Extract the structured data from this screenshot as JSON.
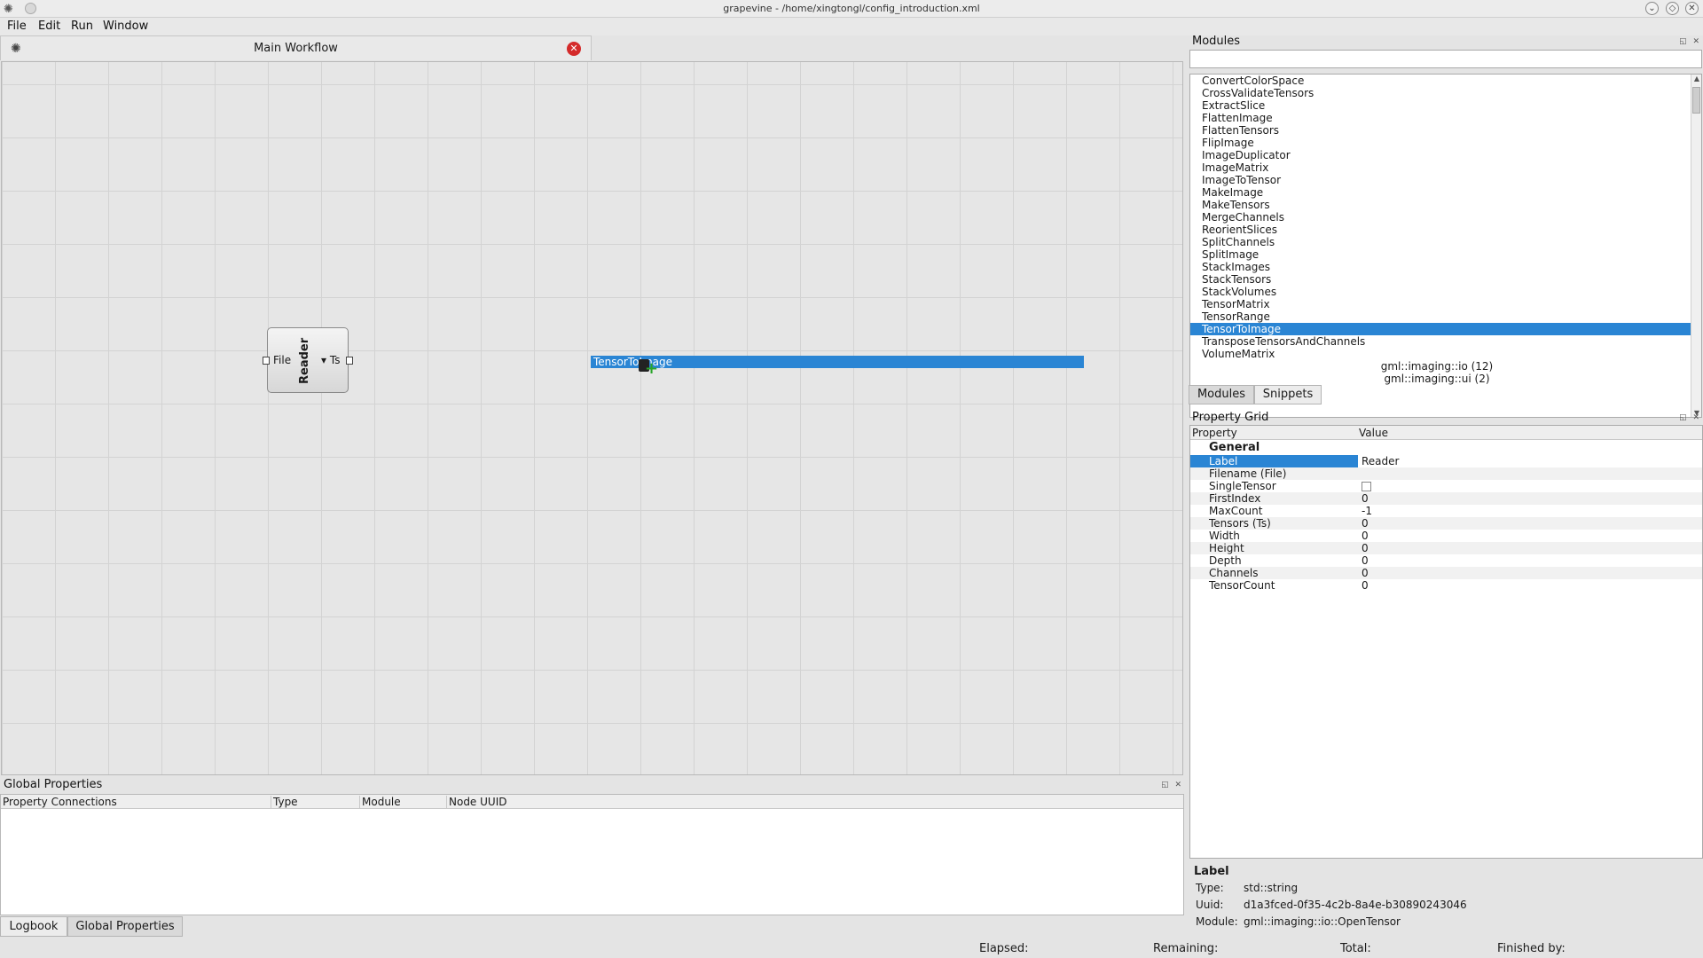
{
  "window": {
    "title": "grapevine - /home/xingtongl/config_introduction.xml",
    "controls": [
      "⌄",
      "◇",
      "✕"
    ]
  },
  "menu": [
    {
      "label": "File",
      "mnemonic": "F"
    },
    {
      "label": "Edit",
      "mnemonic": "E"
    },
    {
      "label": "Run",
      "mnemonic": "R"
    },
    {
      "label": "Window",
      "mnemonic": "W"
    }
  ],
  "workflow_tab": {
    "title": "Main Workflow"
  },
  "canvas": {
    "node": {
      "title": "Reader",
      "input_label": "File",
      "output_label": "Ts"
    },
    "drag_label": "TensorToImage"
  },
  "global_properties": {
    "title": "Global Properties",
    "columns": [
      "Property Connections",
      "Type",
      "Module",
      "Node UUID"
    ]
  },
  "bottom_tabs": [
    "Logbook",
    "Global Properties"
  ],
  "status": {
    "elapsed": "Elapsed:",
    "remaining": "Remaining:",
    "total": "Total:",
    "finished": "Finished by:"
  },
  "modules": {
    "title": "Modules",
    "search_value": "",
    "items": [
      "ConvertColorSpace",
      "CrossValidateTensors",
      "ExtractSlice",
      "FlattenImage",
      "FlattenTensors",
      "FlipImage",
      "ImageDuplicator",
      "ImageMatrix",
      "ImageToTensor",
      "MakeImage",
      "MakeTensors",
      "MergeChannels",
      "ReorientSlices",
      "SplitChannels",
      "SplitImage",
      "StackImages",
      "StackTensors",
      "StackVolumes",
      "TensorMatrix",
      "TensorRange",
      "TensorToImage",
      "TransposeTensorsAndChannels",
      "VolumeMatrix"
    ],
    "selected": "TensorToImage",
    "groups": [
      "gml::imaging::io (12)",
      "gml::imaging::ui (2)"
    ],
    "tabs": [
      "Modules",
      "Snippets"
    ]
  },
  "property_grid": {
    "title": "Property Grid",
    "col_property": "Property",
    "col_value": "Value",
    "section": "General",
    "rows": [
      {
        "key": "Label",
        "value": "Reader"
      },
      {
        "key": "Filename (File)",
        "value": ""
      },
      {
        "key": "SingleTensor",
        "value": ""
      },
      {
        "key": "FirstIndex",
        "value": "0"
      },
      {
        "key": "MaxCount",
        "value": "-1"
      },
      {
        "key": "Tensors (Ts)",
        "value": "0"
      },
      {
        "key": "Width",
        "value": "0"
      },
      {
        "key": "Height",
        "value": "0"
      },
      {
        "key": "Depth",
        "value": "0"
      },
      {
        "key": "Channels",
        "value": "0"
      },
      {
        "key": "TensorCount",
        "value": "0"
      }
    ]
  },
  "info": {
    "title": "Label",
    "type_label": "Type:",
    "type_value": "std::string",
    "uuid_label": "Uuid:",
    "uuid_value": "d1a3fced-0f35-4c2b-8a4e-b30890243046",
    "module_label": "Module:",
    "module_value": "gml::imaging::io::OpenTensor"
  },
  "colors": {
    "selection": "#2a85d4",
    "close_red": "#d42a2a",
    "plus_green": "#2aa52a"
  }
}
